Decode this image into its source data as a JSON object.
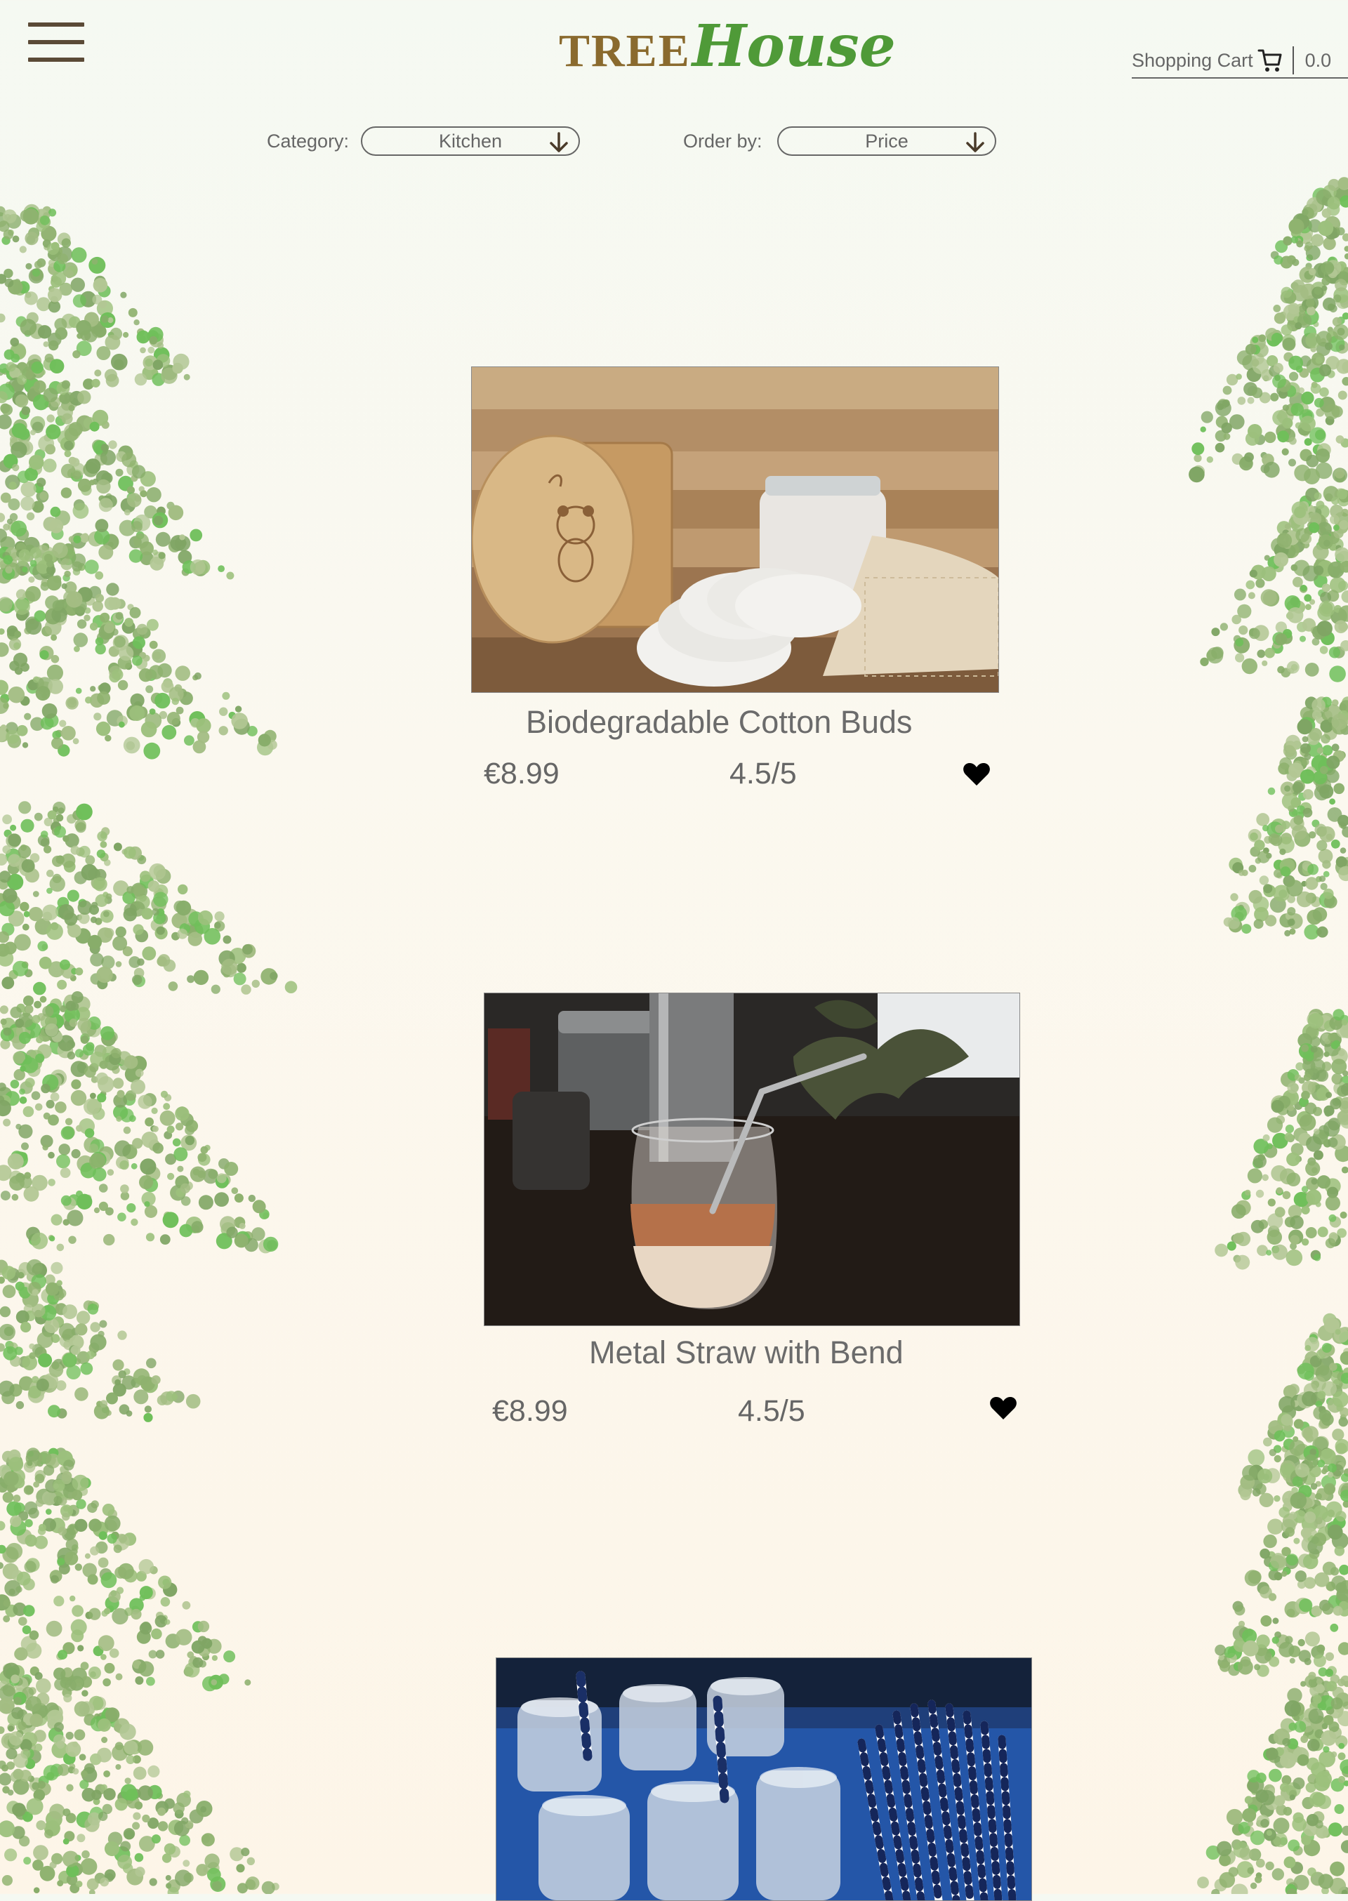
{
  "header": {
    "menu_icon": "hamburger-menu-icon",
    "logo": {
      "part1": "TREE",
      "part2": "House"
    },
    "cart": {
      "label": "Shopping Cart",
      "icon": "shopping-cart-icon",
      "total": "0.0"
    }
  },
  "filters": {
    "category": {
      "label": "Category:",
      "value": "Kitchen",
      "icon": "arrow-down-icon"
    },
    "order": {
      "label": "Order by:",
      "value": "Price",
      "icon": "arrow-down-icon"
    }
  },
  "products": [
    {
      "name": "Biodegradable Cotton Buds",
      "price": "€8.99",
      "rating": "4.5/5",
      "favorite_icon": "heart-icon"
    },
    {
      "name": "Metal Straw with Bend",
      "price": "€8.99",
      "rating": "4.5/5",
      "favorite_icon": "heart-icon"
    },
    {
      "name": "",
      "price": "",
      "rating": "",
      "favorite_icon": "heart-icon"
    }
  ],
  "colors": {
    "logo_brown": "#8a6a2e",
    "logo_green": "#4f9a38",
    "foliage": "#8fb26f",
    "text": "#666666"
  }
}
